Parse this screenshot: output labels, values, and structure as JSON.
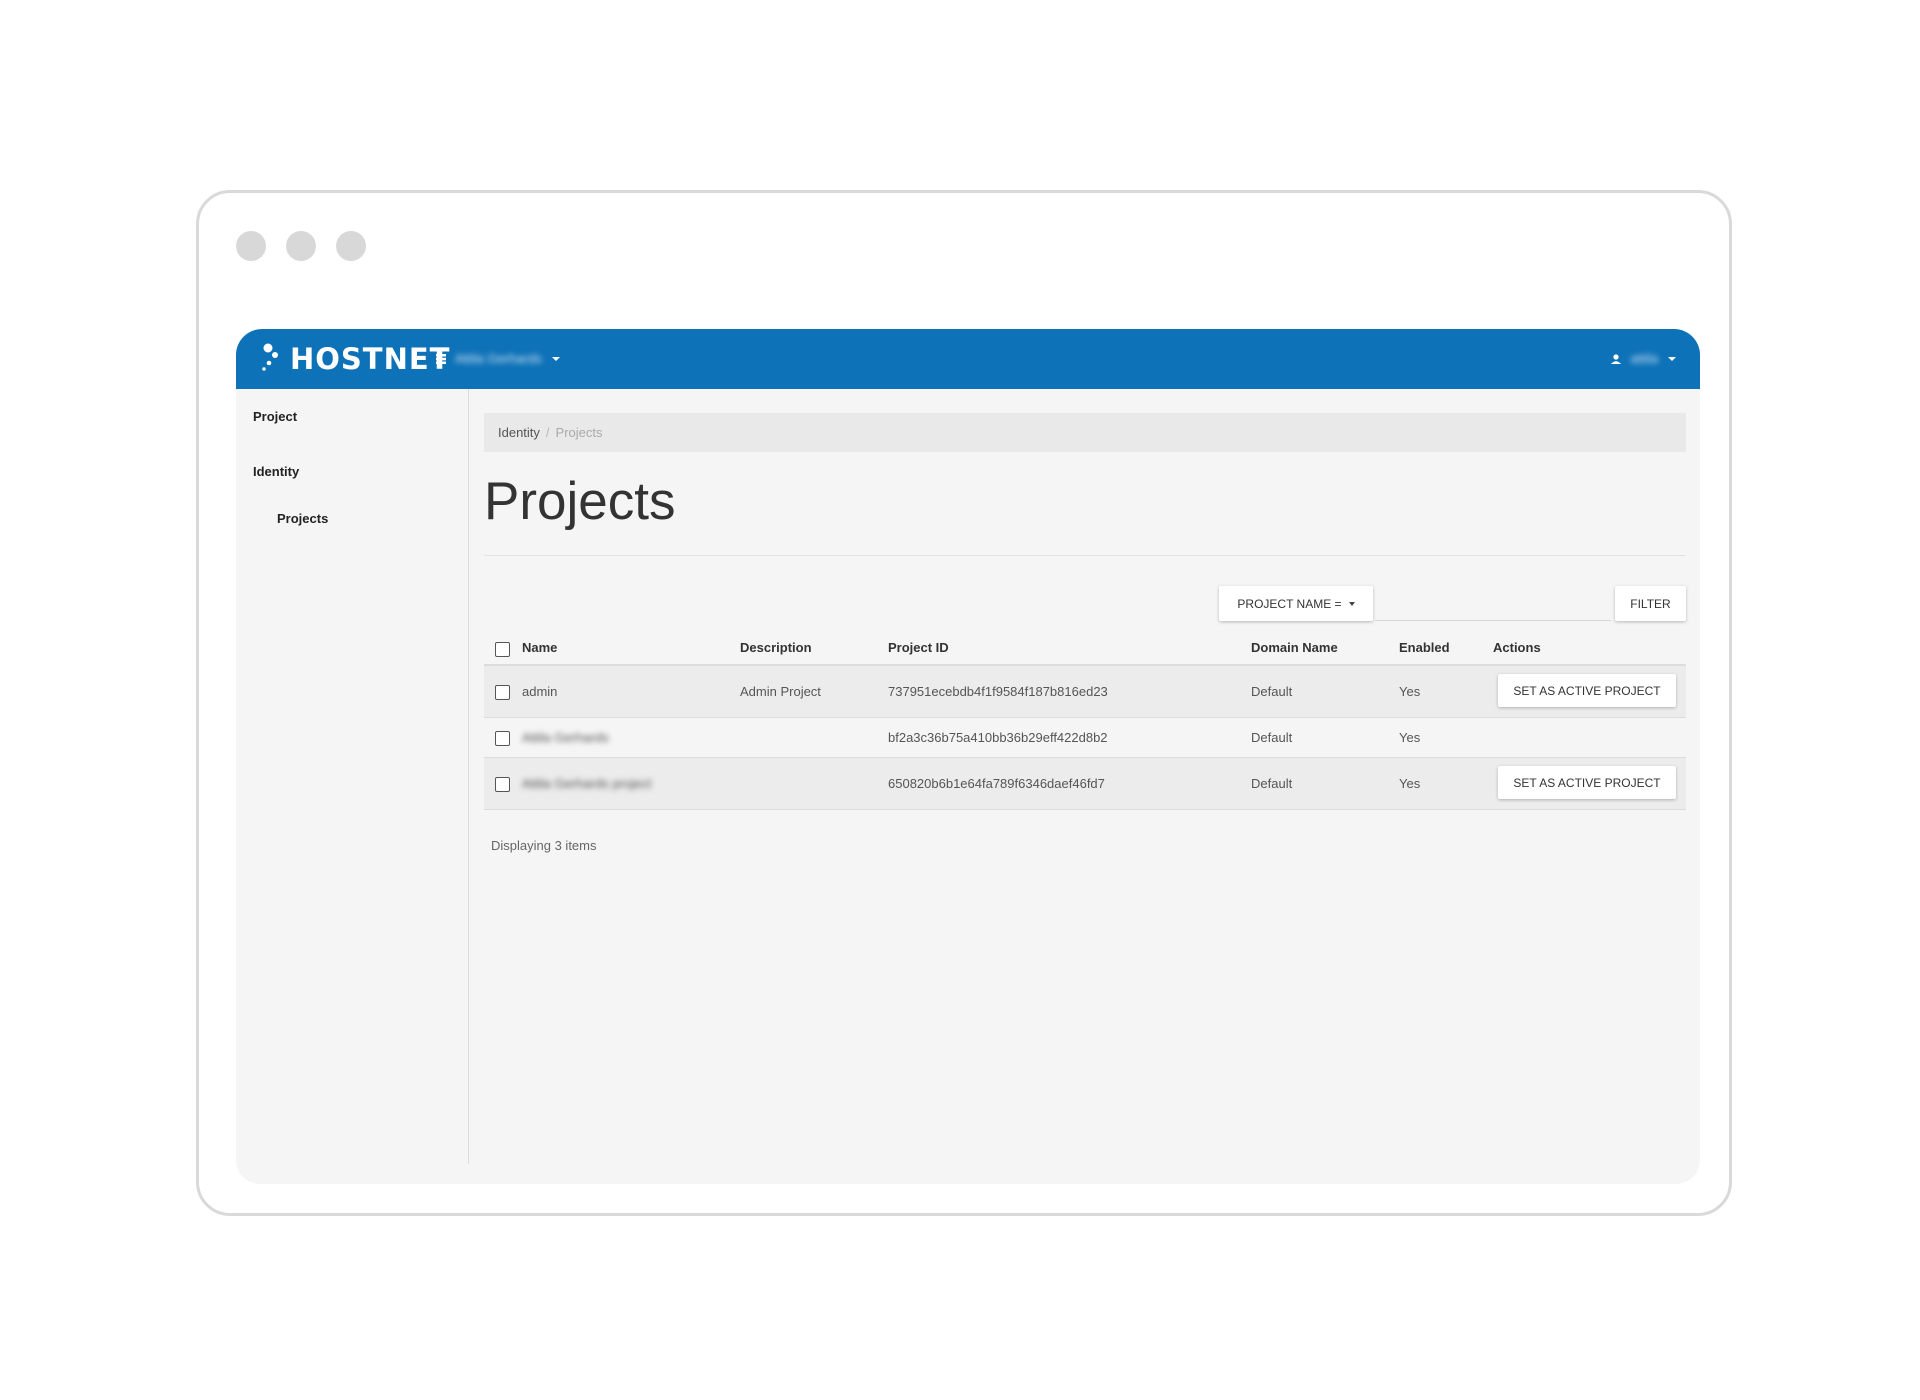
{
  "window": {
    "controls": [
      "window-dot-1",
      "window-dot-2",
      "window-dot-3"
    ]
  },
  "header": {
    "logo_text": "HOSTNET",
    "project_switcher": {
      "icon": "grid-icon",
      "label": "Attila Gerhards"
    },
    "user_menu": {
      "icon": "user-icon",
      "label": "attila"
    },
    "brand_color": "#0e72b8"
  },
  "sidebar": {
    "items": [
      {
        "label": "Project"
      },
      {
        "label": "Identity"
      },
      {
        "label": "Projects"
      }
    ]
  },
  "breadcrumb": {
    "items": [
      "Identity",
      "Projects"
    ],
    "separator": "/"
  },
  "page": {
    "title": "Projects"
  },
  "filter": {
    "field_label": "PROJECT NAME =",
    "input_value": "",
    "button_label": "FILTER"
  },
  "table": {
    "columns": [
      "Name",
      "Description",
      "Project ID",
      "Domain Name",
      "Enabled",
      "Actions"
    ],
    "rows": [
      {
        "name": "admin",
        "description": "Admin Project",
        "project_id": "737951ecebdb4f1f9584f187b816ed23",
        "domain": "Default",
        "enabled": "Yes",
        "action": "SET AS ACTIVE PROJECT"
      },
      {
        "name": "Attila Gerhards",
        "description": "",
        "project_id": "bf2a3c36b75a410bb36b29eff422d8b2",
        "domain": "Default",
        "enabled": "Yes",
        "action": ""
      },
      {
        "name": "Attila Gerhards project",
        "description": "",
        "project_id": "650820b6b1e64fa789f6346daef46fd7",
        "domain": "Default",
        "enabled": "Yes",
        "action": "SET AS ACTIVE PROJECT"
      }
    ],
    "footer": "Displaying 3 items"
  }
}
